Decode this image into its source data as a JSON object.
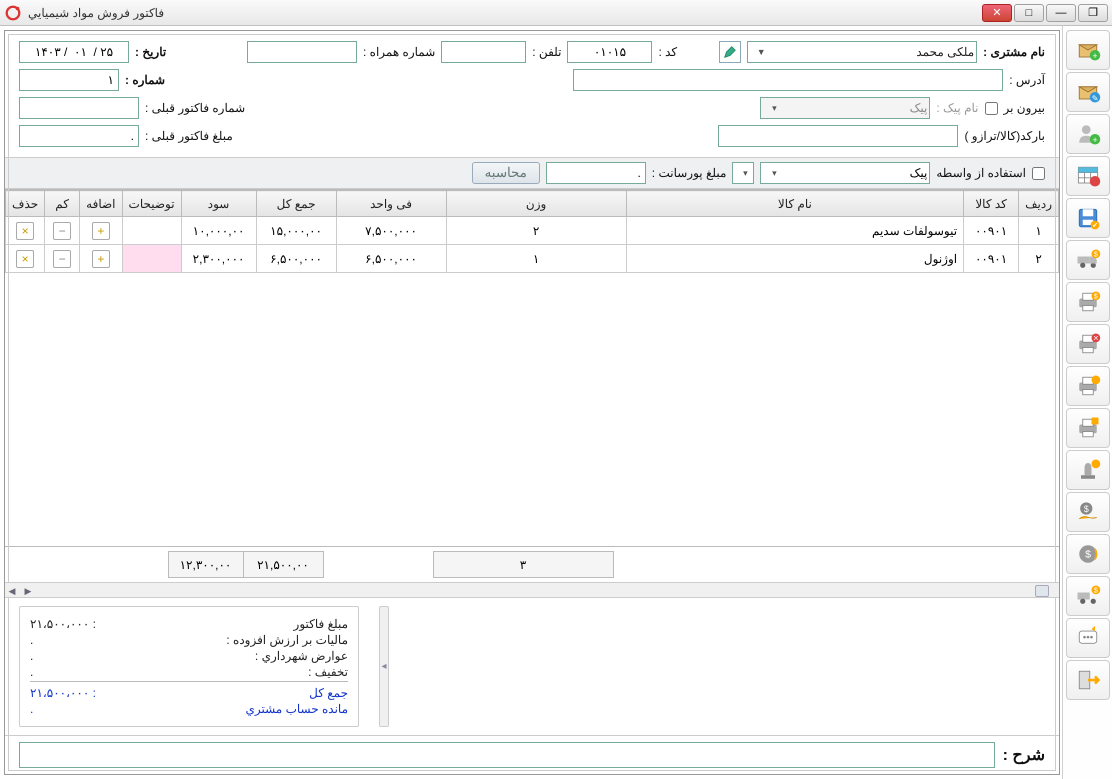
{
  "window": {
    "title": "فاكتور فروش مواد شيميايي"
  },
  "form": {
    "customer_label": "نام مشتری :",
    "customer_value": "ملکی محمد",
    "code_label": "کد :",
    "code_value": "۰۱۰۱۵",
    "phone_label": "تلفن    :",
    "phone_value": "",
    "mobile_label": "شماره همراه :",
    "mobile_value": "",
    "date_label": "تاریخ :",
    "date_value": "۲۵ /  ۰۱  / ۱۴۰۳",
    "address_label": "آدرس      :",
    "address_value": "",
    "number_label": "شماره :",
    "number_value": "۱",
    "courier_out_label": "بیرون بر",
    "courier_name_label": "نام پیک :",
    "courier_combo": "پیک",
    "prev_invoice_label": "شماره فاکتور قبلی :",
    "prev_invoice_value": "",
    "barcode_label": "بارکد(کالا/ترازو )",
    "barcode_value": "",
    "prev_amount_label": "مبلغ فاکتور قبلی :",
    "prev_amount_value": ".",
    "use_agent_label": "استفاده از واسطه",
    "agent_combo": "پیک",
    "commission_label": "مبلغ پورسانت :",
    "commission_value": ".",
    "calc_btn": "محاسبه"
  },
  "grid": {
    "headers": {
      "row": "ردیف",
      "code": "کد کالا",
      "name": "نام کالا",
      "weight": "وزن",
      "unit_price": "فی واحد",
      "total": "جمع کل",
      "profit": "سود",
      "desc": "توضیحات",
      "add": "اضافه",
      "sub": "کم",
      "del": "حذف"
    },
    "rows": [
      {
        "row": "۱",
        "code": "۰۰۹۰۱",
        "name": "تیوسولفات سدیم",
        "weight": "۲",
        "unit_price": "۷,۵۰۰,۰۰۰",
        "total": "۱۵,۰۰۰,۰۰",
        "profit": "۱۰,۰۰۰,۰۰",
        "desc": ""
      },
      {
        "row": "۲",
        "code": "۰۰۹۰۱",
        "name": "اوژنول",
        "weight": "۱",
        "unit_price": "۶,۵۰۰,۰۰۰",
        "total": "۶,۵۰۰,۰۰۰",
        "profit": "۲,۳۰۰,۰۰۰",
        "desc": ""
      }
    ],
    "totals": {
      "weight": "۳",
      "total": "۲۱,۵۰۰,۰۰",
      "profit": "۱۲,۳۰۰,۰۰"
    }
  },
  "summary": {
    "invoice_amount_label": "مبلغ فاكتور",
    "invoice_amount_value": "۲۱،۵۰۰،۰۰۰ :",
    "vat_label": "ماليات بر ارزش افزوده   :",
    "vat_value": ".",
    "municipal_label": "عوارض شهرداري   :",
    "municipal_value": ".",
    "discount_label": "تخفيف    :",
    "discount_value": ".",
    "grand_label": "جمع كل",
    "grand_value": "۲۱،۵۰۰،۰۰۰ :",
    "balance_label": "مانده حساب مشتري",
    "balance_value": "."
  },
  "bottom": {
    "desc_label": "شرح  :"
  },
  "icons": {
    "plus": "+",
    "minus": "−",
    "del": "×"
  }
}
